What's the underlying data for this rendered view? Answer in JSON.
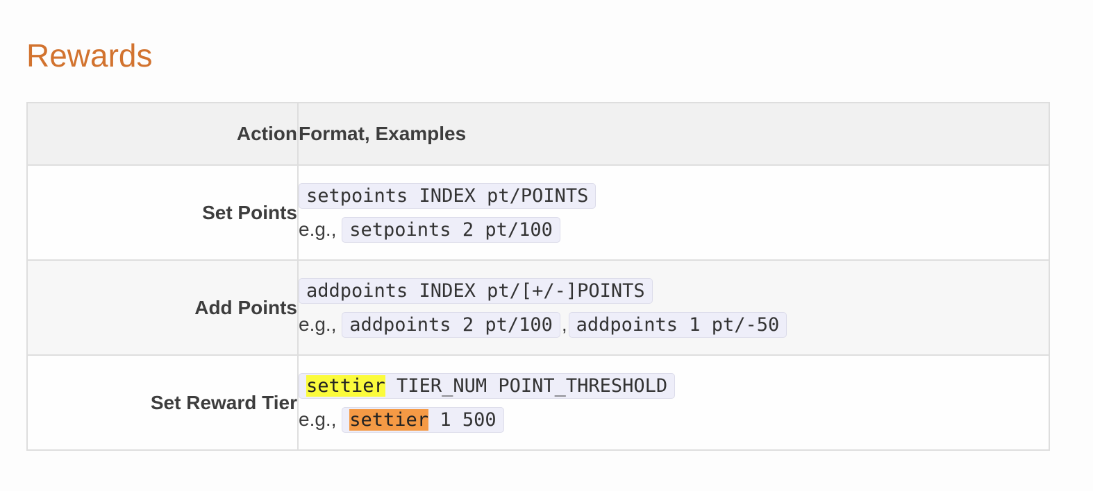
{
  "section": {
    "title": "Rewards"
  },
  "table": {
    "headers": {
      "action": "Action",
      "format": "Format, Examples"
    },
    "rows": [
      {
        "action": "Set Points",
        "format": "setpoints INDEX pt/POINTS",
        "eg_prefix": "e.g.,",
        "examples": [
          "setpoints 2 pt/100"
        ]
      },
      {
        "action": "Add Points",
        "format": "addpoints INDEX pt/[+/-]POINTS",
        "eg_prefix": "e.g.,",
        "examples": [
          "addpoints 2 pt/100",
          "addpoints 1 pt/-50"
        ],
        "separator": ","
      },
      {
        "action": "Set Reward Tier",
        "format_highlight": "settier",
        "format_rest": " TIER_NUM POINT_THRESHOLD",
        "eg_prefix": "e.g.,",
        "example_highlight": "settier",
        "example_rest": " 1 500"
      }
    ]
  },
  "colors": {
    "title": "#d2732f",
    "highlight_yellow": "#fbfb3c",
    "highlight_orange": "#f59a45",
    "code_background": "#eeeef9"
  }
}
